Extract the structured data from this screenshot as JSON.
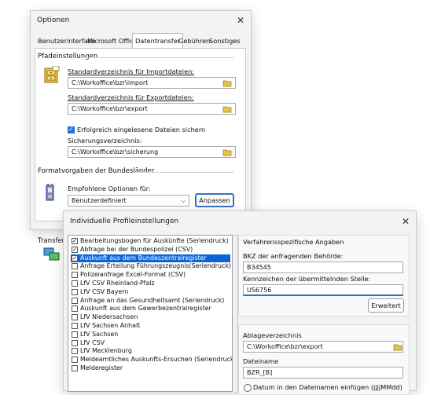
{
  "options_dialog": {
    "title": "Optionen",
    "tabs": [
      "Benutzerinterface",
      "Microsoft Office",
      "Datentransfer",
      "Gebühren",
      "Sonstiges"
    ],
    "active_tab": "Datentransfer",
    "path_group": "Pfadeinstellungen",
    "import_label": "Standardverzeichnis für Importdateien:",
    "import_value": "C:\\Workoffice\\bzr\\import",
    "export_label": "Standardverzeichnis für Exportdateien:",
    "export_value": "C:\\Workoffice\\bzr\\export",
    "backup_checkbox_label": "Erfolgreich eingelesene Dateien sichern",
    "backup_checked": true,
    "backup_dir_label": "Sicherungsverzeichnis:",
    "backup_dir_value": "C:\\Workoffice\\bzr\\sicherung",
    "format_group": "Formatvorgaben der Bundesländer",
    "recommended_label": "Empfohlene Optionen für:",
    "recommended_value": "Benutzerdefiniert",
    "adjust_button": "Anpassen",
    "transfer_group_partial": "Transfere"
  },
  "profile_dialog": {
    "title": "Individuelle Profileinstellungen",
    "list_items": [
      {
        "label": "Bearbeitungsbogen für Auskünfte (Seriendruck)",
        "checked": true,
        "selected": false
      },
      {
        "label": "Abfrage bei der Bundespolizei (CSV)",
        "checked": true,
        "selected": false
      },
      {
        "label": "Auskunft aus dem Bundeszentralregister",
        "checked": true,
        "selected": true
      },
      {
        "label": "Anfrage Erteilung Führungszeugnis(Seriendruck)",
        "checked": false,
        "selected": false
      },
      {
        "label": "Polizeianfrage Excel-Format (CSV)",
        "checked": false,
        "selected": false
      },
      {
        "label": "LfV CSV Rheinland-Pfalz",
        "checked": false,
        "selected": false
      },
      {
        "label": "LfV CSV Bayern",
        "checked": false,
        "selected": false
      },
      {
        "label": "Anfrage an das Gesundheitsamt (Seriendruck)",
        "checked": false,
        "selected": false
      },
      {
        "label": "Auskunft aus dem Gewerbezentralregister",
        "checked": false,
        "selected": false
      },
      {
        "label": "LfV Niedersachsen",
        "checked": false,
        "selected": false
      },
      {
        "label": "LfV Sachsen Anhalt",
        "checked": false,
        "selected": false
      },
      {
        "label": "LfV Sachsen",
        "checked": false,
        "selected": false
      },
      {
        "label": "LfV CSV",
        "checked": false,
        "selected": false
      },
      {
        "label": "LfV Mecklenburg",
        "checked": false,
        "selected": false
      },
      {
        "label": "Meldeamtliches Auskunfts-Ersuchen (Seriendruck)",
        "checked": false,
        "selected": false
      },
      {
        "label": "Melderegister",
        "checked": false,
        "selected": false
      }
    ],
    "procedure_group": "Verfahrensspezifische Angaben",
    "bkz_label": "BKZ der anfragenden Behörde:",
    "bkz_value": "B34545",
    "sign_label": "Kennzeichen der übermittelnden Stelle:",
    "sign_value": "US6756",
    "extended_button": "Erweitert",
    "storage_dir_label": "Ablageverzeichnis",
    "storage_dir_value": "C:\\Workoffice\\bzr\\export",
    "filename_label": "Dateiname",
    "filename_value": "BZR_[B]",
    "bottom_partial": "Datum in den Dateinamen einfügen (jjjjMMdd)"
  },
  "colors": {
    "selection": "#0a64d8",
    "accent": "#2b6fd6",
    "folder": "#e8c24a"
  }
}
